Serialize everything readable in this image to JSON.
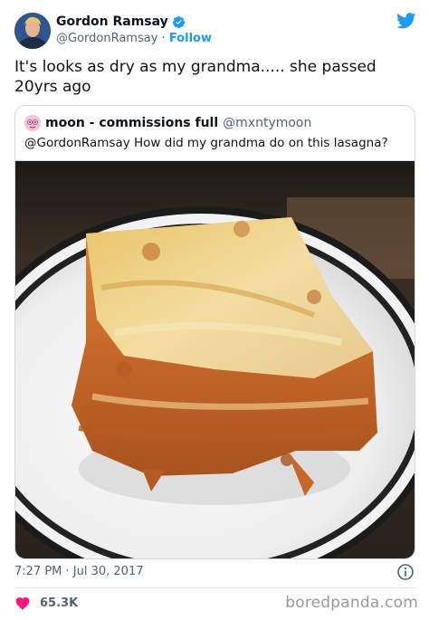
{
  "author": {
    "display_name": "Gordon Ramsay",
    "handle": "@GordonRamsay",
    "separator": "·",
    "follow_label": "Follow"
  },
  "tweet": {
    "text": "It's looks as dry as my grandma..... she passed 20yrs ago"
  },
  "quoted": {
    "display_name": "moon - commissions full",
    "handle": "@mxntymoon",
    "text": "@GordonRamsay How did my grandma do on this lasagna?"
  },
  "footer": {
    "timestamp": "7:27 PM · Jul 30, 2017",
    "likes": "65.3K"
  },
  "watermark": "boredpanda.com",
  "colors": {
    "accent": "#1d9bf0",
    "heart": "#f91880",
    "text": "#0f1419",
    "muted": "#536471"
  },
  "icons": [
    "verified-badge-icon",
    "twitter-bird-icon",
    "info-icon",
    "heart-icon"
  ]
}
